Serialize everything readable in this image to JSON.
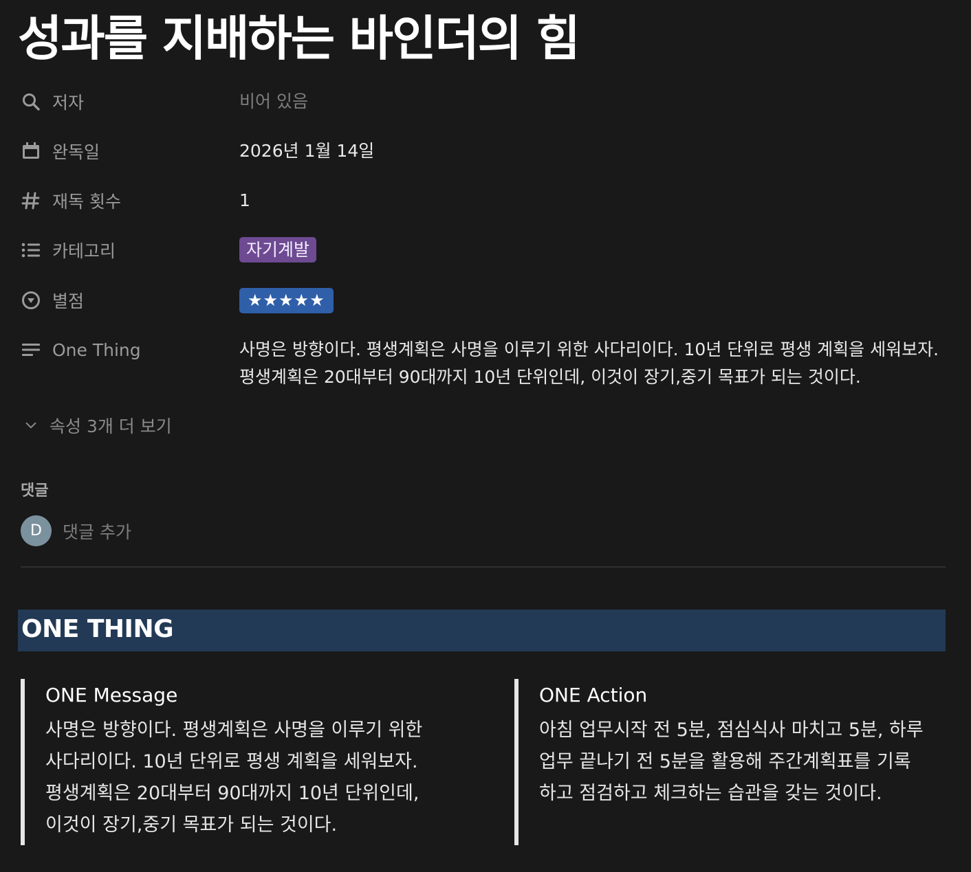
{
  "page": {
    "title": "성과를 지배하는 바인더의 힘"
  },
  "properties": {
    "author": {
      "icon": "search-icon",
      "label": "저자",
      "value": "비어 있음"
    },
    "finished_date": {
      "icon": "calendar-icon",
      "label": "완독일",
      "value": "2026년 1월 14일"
    },
    "reread_count": {
      "icon": "hash-icon",
      "label": "재독 횟수",
      "value": "1"
    },
    "category": {
      "icon": "list-icon",
      "label": "카테고리",
      "tag": "자기계발",
      "tag_color": "#6d4a91"
    },
    "rating": {
      "icon": "chevron-circle-icon",
      "label": "별점",
      "stars": 5,
      "tag_color": "#2f5fa8"
    },
    "one_thing": {
      "icon": "text-lines-icon",
      "label": "One Thing",
      "value": "사명은 방향이다. 평생계획은 사명을 이루기 위한 사다리이다. 10년 단위로 평생 계획을 세워보자. 평생계획은 20대부터 90대까지 10년 단위인데, 이것이 장기,중기 목표가 되는 것이다."
    }
  },
  "more_properties": {
    "label": "속성 3개 더 보기"
  },
  "comments": {
    "label": "댓글",
    "avatar_initial": "D",
    "placeholder": "댓글 추가"
  },
  "section": {
    "heading": "ONE THING",
    "heading_bg": "#223a55",
    "message": {
      "title": "ONE Message",
      "body": "사명은 방향이다. 평생계획은 사명을 이루기 위한 사다리이다. 10년 단위로 평생 계획을 세워보자. 평생계획은 20대부터 90대까지 10년 단위인데, 이것이 장기,중기 목표가 되는 것이다."
    },
    "action": {
      "title": "ONE Action",
      "body": "아침 업무시작 전 5분, 점심식사 마치고 5분, 하루 업무 끝나기 전 5분을 활용해 주간계획표를 기록하고 점검하고 체크하는 습관을 갖는 것이다."
    }
  },
  "theme": {
    "background": "#191919"
  }
}
